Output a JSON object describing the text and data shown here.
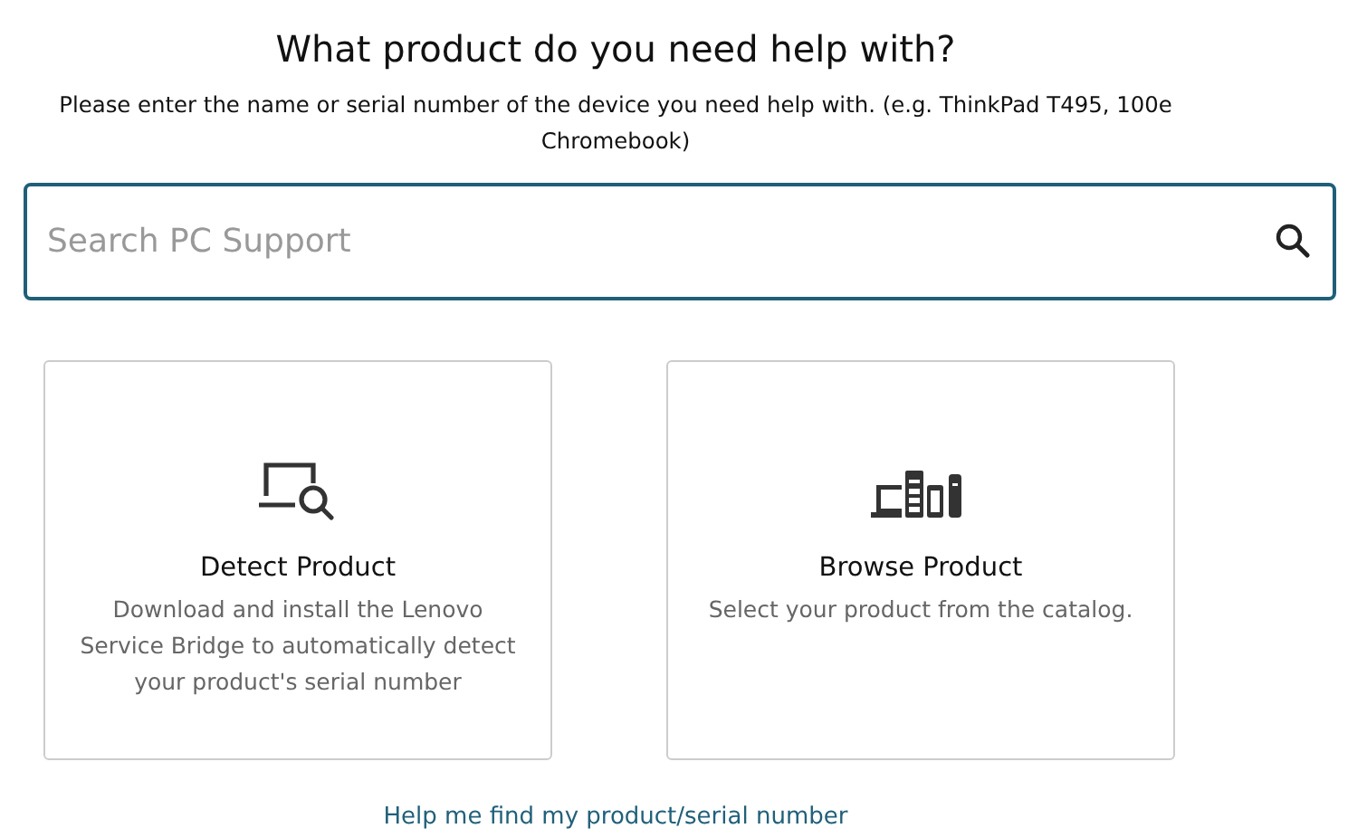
{
  "heading": "What product do you need help with?",
  "instructions": "Please enter the name or serial number of the device you need help with. (e.g. ThinkPad T495, 100e Chromebook)",
  "search": {
    "placeholder": "Search PC Support"
  },
  "options": [
    {
      "kind": "detect",
      "title": "Detect Product",
      "description": "Download and install the Lenovo Service Bridge to automatically detect your product's serial number"
    },
    {
      "kind": "browse",
      "title": "Browse Product",
      "description": "Select your product from the catalog."
    }
  ],
  "help_link": "Help me find my product/serial number"
}
